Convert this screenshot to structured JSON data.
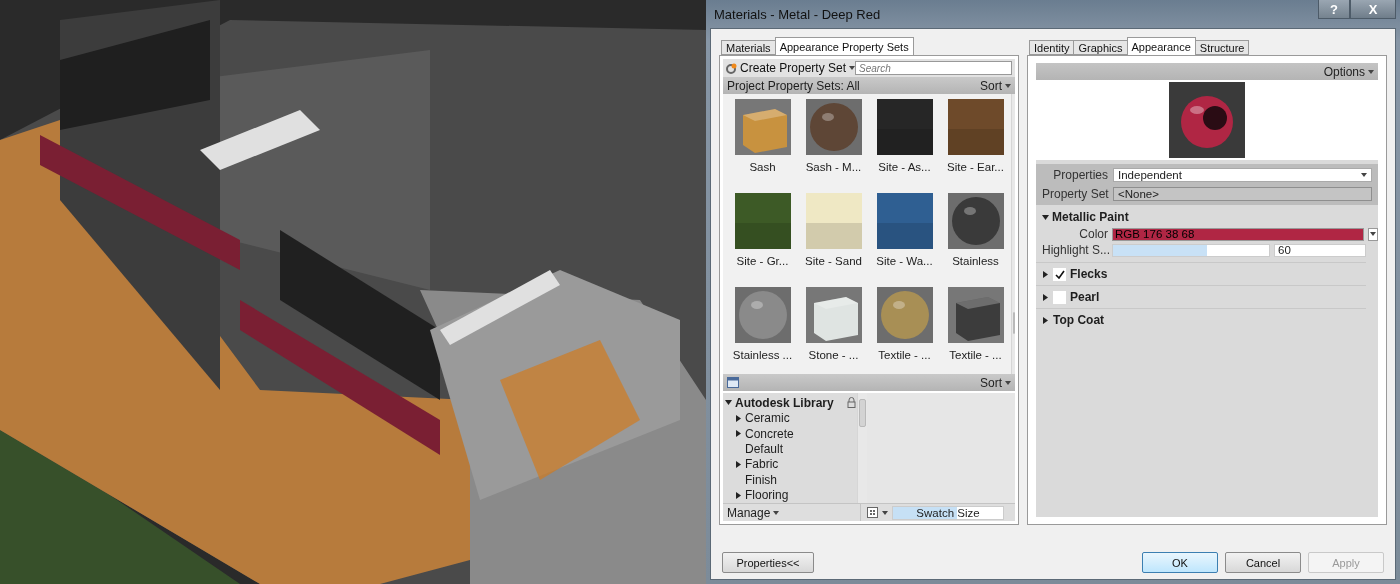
{
  "window": {
    "title": "Materials - Metal - Deep Red",
    "title_buttons": [
      "?",
      "X"
    ]
  },
  "left_tabs": [
    {
      "label": "Materials",
      "selected": false
    },
    {
      "label": "Appearance Property Sets",
      "selected": true
    }
  ],
  "toolbar": {
    "create_label": "Create Property Set",
    "search": {
      "placeholder": "Search"
    }
  },
  "set_header": {
    "label": "Project Property Sets: All",
    "sort": "Sort"
  },
  "swatches": [
    {
      "label": "Sash",
      "kind": "cube",
      "color": "#c8923f"
    },
    {
      "label": "Sash - M...",
      "kind": "sphere",
      "color": "#5e4636"
    },
    {
      "label": "Site - As...",
      "kind": "flat",
      "color": "#262626"
    },
    {
      "label": "Site - Ear...",
      "kind": "flat",
      "color": "#6e4a2a"
    },
    {
      "label": "Site - Gr...",
      "kind": "flat",
      "color": "#3d5a26"
    },
    {
      "label": "Site - Sand",
      "kind": "flat",
      "color": "#efe8c4"
    },
    {
      "label": "Site - Wa...",
      "kind": "flat",
      "color": "#2f5f92"
    },
    {
      "label": "Stainless",
      "kind": "sphere",
      "color": "#3a3a3a"
    },
    {
      "label": "Stainless ...",
      "kind": "sphere",
      "color": "#8a8a8a"
    },
    {
      "label": "Stone - ...",
      "kind": "cube",
      "color": "#dfe4e2"
    },
    {
      "label": "Textile - ...",
      "kind": "sphere",
      "color": "#a88f55"
    },
    {
      "label": "Textile - ...",
      "kind": "cube",
      "color": "#3c3c3c"
    }
  ],
  "library": {
    "sort": "Sort",
    "root": {
      "label": "Autodesk Library",
      "expanded": true,
      "children": [
        {
          "label": "Ceramic",
          "kind": "folder"
        },
        {
          "label": "Concrete",
          "kind": "folder"
        },
        {
          "label": "Default",
          "kind": "leaf"
        },
        {
          "label": "Fabric",
          "kind": "folder"
        },
        {
          "label": "Finish",
          "kind": "leaf"
        },
        {
          "label": "Flooring",
          "kind": "folder"
        }
      ]
    },
    "manage": "Manage",
    "swatch_size": {
      "label": "Swatch Size",
      "level": 0.58
    }
  },
  "properties_button": "Properties<<",
  "right_tabs": [
    {
      "label": "Identity",
      "selected": false
    },
    {
      "label": "Graphics",
      "selected": false
    },
    {
      "label": "Appearance",
      "selected": true
    },
    {
      "label": "Structure",
      "selected": false
    }
  ],
  "options": "Options",
  "properties": [
    {
      "label": "Properties",
      "value": "Independent",
      "kind": "dropdown"
    },
    {
      "label": "Property Set",
      "value": "<None>",
      "kind": "readonly"
    }
  ],
  "metallic_paint": {
    "label": "Metallic Paint",
    "expanded": true,
    "color": {
      "label": "Color",
      "value": "RGB 176 38 68",
      "color": "#b02644"
    },
    "highlight": {
      "label": "Highlight S...",
      "level": 0.6,
      "value": "60"
    }
  },
  "sections": [
    {
      "label": "Flecks",
      "checked": true,
      "kind": "checkbox"
    },
    {
      "label": "Pearl",
      "checked": false,
      "kind": "checkbox"
    },
    {
      "label": "Top Coat",
      "kind": "plain"
    }
  ],
  "buttons": [
    {
      "label": "OK",
      "kind": "default"
    },
    {
      "label": "Cancel",
      "kind": "normal"
    },
    {
      "label": "Apply",
      "kind": "disabled"
    }
  ]
}
